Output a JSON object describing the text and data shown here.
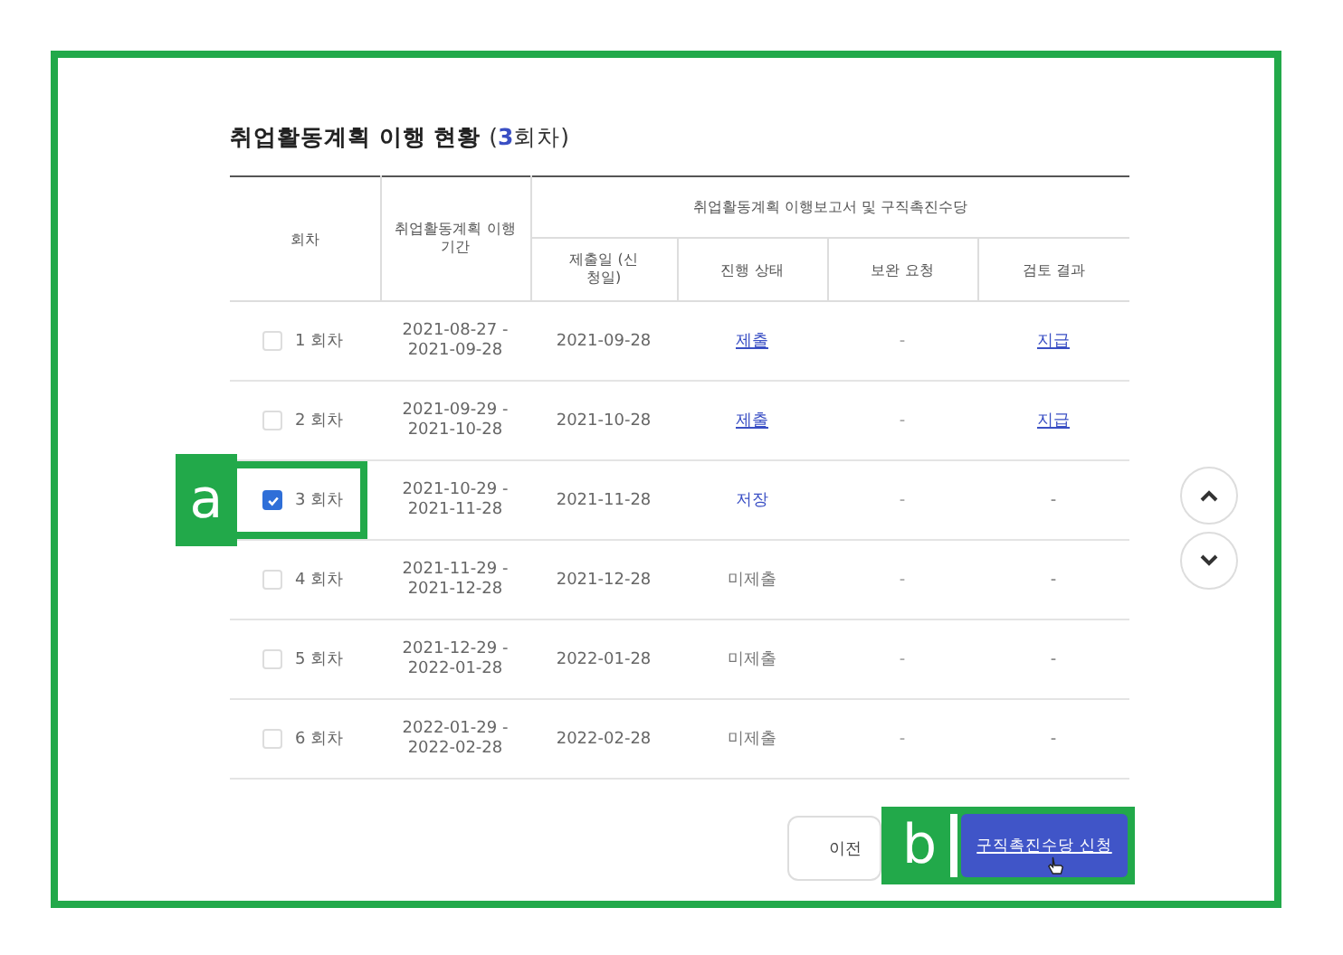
{
  "section": {
    "title": "취업활동계획 이행 현황",
    "count_open": "(",
    "count": "3",
    "count_unit": "회차)"
  },
  "table": {
    "columns": {
      "round": "회차",
      "period": "취업활동계획 이행 기간",
      "group": "취업활동계획 이행보고서 및 구직촉진수당",
      "submitted": "제출일 (신청일)",
      "status": "진행 상태",
      "supplement": "보완 요청",
      "review": "검토 결과"
    },
    "rows": [
      {
        "checked": false,
        "round": "1 회차",
        "period_start": "2021-08-27 -",
        "period_end": "2021-09-28",
        "submitted": "2021-09-28",
        "status": {
          "text": "제출",
          "kind": "link"
        },
        "supplement": "-",
        "review": {
          "text": "지급",
          "kind": "link"
        }
      },
      {
        "checked": false,
        "round": "2 회차",
        "period_start": "2021-09-29 -",
        "period_end": "2021-10-28",
        "submitted": "2021-10-28",
        "status": {
          "text": "제출",
          "kind": "link"
        },
        "supplement": "-",
        "review": {
          "text": "지급",
          "kind": "link"
        }
      },
      {
        "checked": true,
        "round": "3 회차",
        "period_start": "2021-10-29 -",
        "period_end": "2021-11-28",
        "submitted": "2021-11-28",
        "status": {
          "text": "저장",
          "kind": "saved"
        },
        "supplement": "-",
        "review": {
          "text": "-",
          "kind": "plain"
        },
        "annotation": "a"
      },
      {
        "checked": false,
        "round": "4 회차",
        "period_start": "2021-11-29 -",
        "period_end": "2021-12-28",
        "submitted": "2021-12-28",
        "status": {
          "text": "미제출",
          "kind": "plain"
        },
        "supplement": "-",
        "review": {
          "text": "-",
          "kind": "plain"
        }
      },
      {
        "checked": false,
        "round": "5 회차",
        "period_start": "2021-12-29 -",
        "period_end": "2022-01-28",
        "submitted": "2022-01-28",
        "status": {
          "text": "미제출",
          "kind": "plain"
        },
        "supplement": "-",
        "review": {
          "text": "-",
          "kind": "plain"
        }
      },
      {
        "checked": false,
        "round": "6 회차",
        "period_start": "2022-01-29 -",
        "period_end": "2022-02-28",
        "submitted": "2022-02-28",
        "status": {
          "text": "미제출",
          "kind": "plain"
        },
        "supplement": "-",
        "review": {
          "text": "-",
          "kind": "plain"
        }
      }
    ]
  },
  "buttons": {
    "previous": "이전",
    "apply": "구직촉진수당 신청",
    "apply_annotation": "b"
  }
}
